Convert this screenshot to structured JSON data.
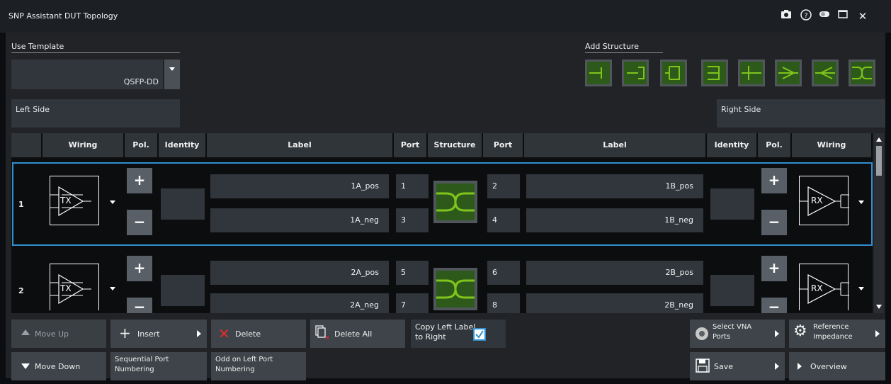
{
  "window": {
    "title": "SNP Assistant DUT Topology"
  },
  "template": {
    "label": "Use Template",
    "value": "QSFP-DD"
  },
  "left_side": {
    "label": "Left Side"
  },
  "right_side": {
    "label": "Right Side"
  },
  "add_structure": {
    "label": "Add Structure"
  },
  "table": {
    "headers": {
      "wiring_left": "Wiring",
      "pol_left": "Pol.",
      "identity_left": "Identity",
      "label_left": "Label",
      "port_left": "Port",
      "structure": "Structure",
      "port_right": "Port",
      "label_right": "Label",
      "identity_right": "Identity",
      "pol_right": "Pol.",
      "wiring_right": "Wiring"
    },
    "rows": [
      {
        "num": "1",
        "left_label_pos": "1A_pos",
        "left_label_neg": "1A_neg",
        "left_port_pos": "1",
        "left_port_neg": "3",
        "right_port_pos": "2",
        "right_port_neg": "4",
        "right_label_pos": "1B_pos",
        "right_label_neg": "1B_neg",
        "tx": "TX",
        "rx": "RX"
      },
      {
        "num": "2",
        "left_label_pos": "2A_pos",
        "left_label_neg": "2A_neg",
        "left_port_pos": "5",
        "left_port_neg": "7",
        "right_port_pos": "6",
        "right_port_neg": "8",
        "right_label_pos": "2B_pos",
        "right_label_neg": "2B_neg",
        "tx": "TX",
        "rx": "RX"
      }
    ],
    "plus": "+",
    "minus": "−"
  },
  "buttons": {
    "move_up": "Move Up",
    "insert": "Insert",
    "delete": "Delete",
    "delete_all": "Delete All",
    "copy_left_label_1": "Copy Left Label",
    "copy_left_label_2": "to Right",
    "select_vna_1": "Select VNA",
    "select_vna_2": "Ports",
    "ref_imp_1": "Reference",
    "ref_imp_2": "Impedance",
    "move_down": "Move Down",
    "seq_port_1": "Sequential Port",
    "seq_port_2": "Numbering",
    "odd_left_1": "Odd on Left Port",
    "odd_left_2": "Numbering",
    "save": "Save",
    "overview": "Overview"
  },
  "colors": {
    "accent": "#2f8fd0",
    "structure_green": "#7fc41c",
    "structure_bg": "#2d5a1a"
  }
}
